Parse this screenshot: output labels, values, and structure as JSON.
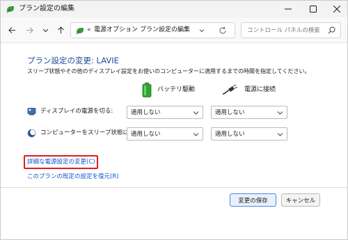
{
  "window": {
    "title": "プラン設定の編集",
    "icon": "power-options-icon"
  },
  "nav": {
    "back_icon": "back-arrow-icon",
    "forward_icon": "forward-arrow-icon",
    "recent_icon": "chevron-down-icon",
    "up_icon": "up-arrow-icon"
  },
  "address": {
    "prefix": "«",
    "crumbs": [
      "電源オプション",
      "プラン設定の編集"
    ],
    "separator": "›"
  },
  "search": {
    "placeholder": "コントロール パネルの検索"
  },
  "main": {
    "heading": "プラン設定の変更: LAVIE",
    "description": "スリープ状態やその他のディスプレイ設定をお使いのコンピューターに適用するまでの時間を指定してください。",
    "columns": {
      "battery": "バッテリ駆動",
      "plugged_in": "電源に接続"
    },
    "rows": [
      {
        "label": "ディスプレイの電源を切る:",
        "battery_value": "適用しない",
        "plugged_value": "適用しない"
      },
      {
        "label": "コンピューターをスリープ状態にする:",
        "battery_value": "適用しない",
        "plugged_value": "適用しない"
      }
    ],
    "links": {
      "advanced": "詳細な電源設定の変更(C)",
      "restore": "このプランの既定の設定を復元(R)"
    }
  },
  "footer": {
    "save_label": "変更の保存",
    "cancel_label": "キャンセル"
  },
  "colors": {
    "heading": "#1f4e9c",
    "link": "#0a58ca",
    "highlight": "#e01c1c",
    "primary_border": "#4a86d8"
  }
}
